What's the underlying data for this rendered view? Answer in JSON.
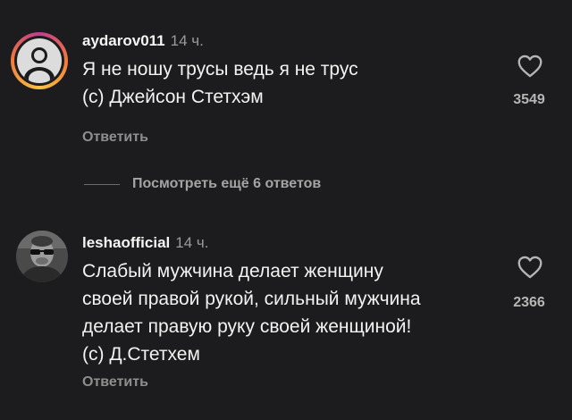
{
  "comments": [
    {
      "username": "aydarov011",
      "time": "14 ч.",
      "lines": [
        "Я не ношу трусы ведь я не трус",
        "(с) Джейсон Стетхэм"
      ],
      "likes": "3549",
      "reply_label": "Ответить",
      "avatar": "story-ring-avatar"
    },
    {
      "username": "leshaofficial",
      "time": "14 ч.",
      "lines": [
        "Слабый мужчина делает женщину",
        "своей правой рукой, сильный мужчина",
        "делает правую руку своей женщиной!",
        "(с) Д.Стетхем"
      ],
      "likes": "2366",
      "reply_label": "Ответить",
      "avatar": "profile-photo-avatar"
    }
  ],
  "view_more_replies": "Посмотреть ещё 6 ответов",
  "icons": {
    "like": "heart-outline-icon"
  },
  "colors": {
    "background": "#1c1c1e",
    "secondary_text": "#8e8e8e",
    "story_ring_start": "#f9a23c",
    "story_ring_end": "#c43a8f"
  }
}
